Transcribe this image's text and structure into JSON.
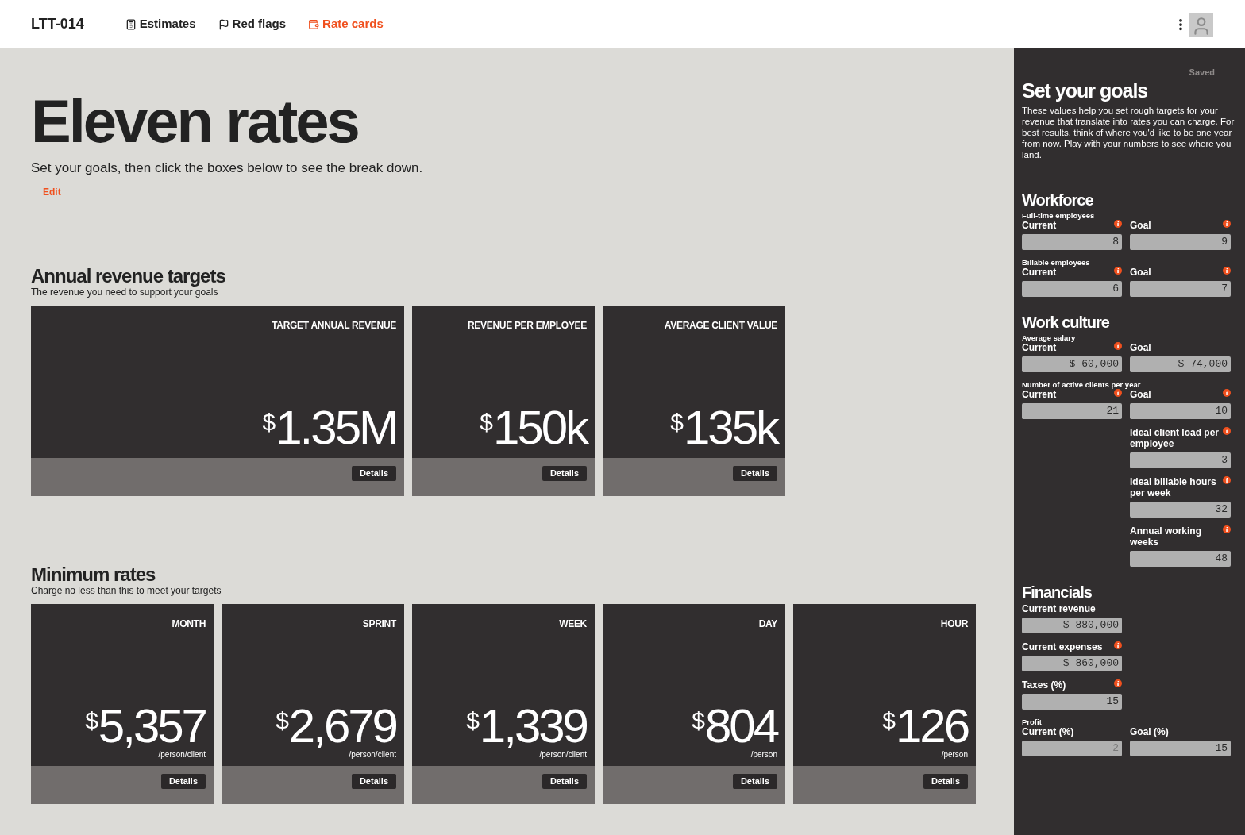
{
  "brand": "LTT-014",
  "tabs": [
    {
      "label": "Estimates",
      "selected": false
    },
    {
      "label": "Red flags",
      "selected": false
    },
    {
      "label": "Rate cards",
      "selected": true
    }
  ],
  "main": {
    "title": "Eleven rates",
    "subtitle": "Set your goals, then click the boxes below to see the break down.",
    "edit_link": "Edit",
    "sections": [
      {
        "title": "Annual revenue targets",
        "subtitle": "The revenue you need to support your goals",
        "kind": "wide",
        "cards": [
          {
            "label": "TARGET ANNUAL REVENUE",
            "currency": "$",
            "amount": "1.35M",
            "button": "Details"
          },
          {
            "label": "REVENUE PER EMPLOYEE",
            "currency": "$",
            "amount": "150k",
            "button": "Details"
          },
          {
            "label": "AVERAGE CLIENT VALUE",
            "currency": "$",
            "amount": "135k",
            "button": "Details"
          }
        ]
      },
      {
        "title": "Minimum rates",
        "subtitle": "Charge no less than this to meet your targets",
        "kind": "tall",
        "cards": [
          {
            "label": "MONTH",
            "currency": "$",
            "amount": "5,357",
            "unit": "/person/client",
            "button": "Details"
          },
          {
            "label": "SPRINT",
            "currency": "$",
            "amount": "2,679",
            "unit": "/person/client",
            "button": "Details"
          },
          {
            "label": "WEEK",
            "currency": "$",
            "amount": "1,339",
            "unit": "/person/client",
            "button": "Details"
          },
          {
            "label": "DAY",
            "currency": "$",
            "amount": "804",
            "unit": "/person",
            "button": "Details"
          },
          {
            "label": "HOUR",
            "currency": "$",
            "amount": "126",
            "unit": "/person",
            "button": "Details"
          }
        ]
      }
    ]
  },
  "sidebar": {
    "status": "Saved",
    "title": "Set your goals",
    "intro": "These values help you set rough targets for your revenue that translate into rates you can charge. For best results, think of where you'd like to be one year from now. Play with your numbers to see where you land.",
    "sections": [
      {
        "title": "Workforce",
        "groups": [
          {
            "label": "Full-time employees",
            "left": {
              "label": "Current",
              "value": "8",
              "info": true,
              "disabled": false
            },
            "right": {
              "label": "Goal",
              "value": "9",
              "info": true,
              "disabled": false
            }
          },
          {
            "label": "Billable employees",
            "left": {
              "label": "Current",
              "value": "6",
              "info": true,
              "disabled": false
            },
            "right": {
              "label": "Goal",
              "value": "7",
              "info": true,
              "disabled": false
            }
          }
        ]
      },
      {
        "title": "Work culture",
        "groups": [
          {
            "label": "Average salary",
            "left": {
              "label": "Current",
              "value": "$ 60,000",
              "info": true,
              "disabled": false
            },
            "right": {
              "label": "Goal",
              "value": "$ 74,000",
              "info": false,
              "disabled": false
            }
          },
          {
            "label": "Number of active clients per year",
            "left": {
              "label": "Current",
              "value": "21",
              "info": true,
              "disabled": false
            },
            "right": {
              "label": "Goal",
              "value": "10",
              "info": true,
              "disabled": false
            }
          },
          {
            "right": {
              "label": "Ideal client load per employee",
              "value": "3",
              "info": true,
              "disabled": false
            }
          },
          {
            "right": {
              "label": "Ideal billable hours per week",
              "value": "32",
              "info": true,
              "disabled": false
            }
          },
          {
            "right": {
              "label": "Annual working weeks",
              "value": "48",
              "info": true,
              "disabled": false
            }
          }
        ]
      },
      {
        "title": "Financials",
        "groups": [
          {
            "left": {
              "label": "Current revenue",
              "value": "$ 880,000",
              "info": false,
              "disabled": false
            }
          },
          {
            "left": {
              "label": "Current expenses",
              "value": "$ 860,000",
              "info": true,
              "disabled": false
            }
          },
          {
            "left": {
              "label": "Taxes (%)",
              "value": "15",
              "info": true,
              "disabled": false
            }
          },
          {
            "label": "Profit",
            "left": {
              "label": "Current (%)",
              "value": "2",
              "info": false,
              "disabled": true
            },
            "right": {
              "label": "Goal (%)",
              "value": "15",
              "info": false,
              "disabled": false
            }
          }
        ]
      }
    ]
  }
}
